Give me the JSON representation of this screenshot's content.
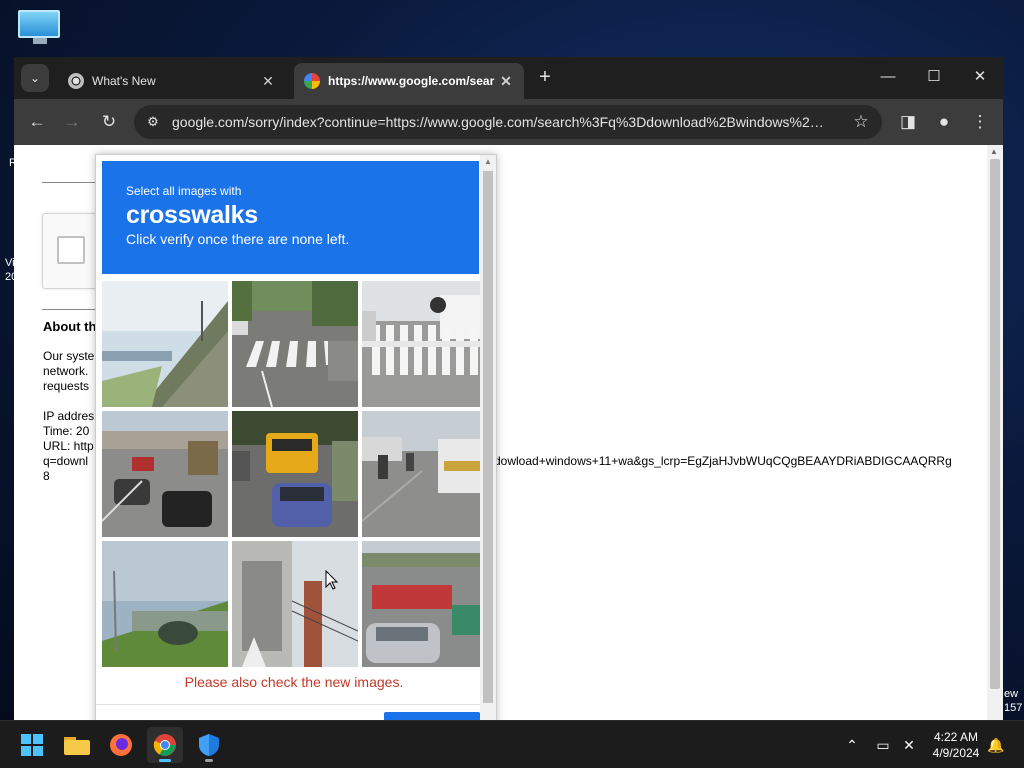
{
  "desktop": {
    "left_fragment_1": "R",
    "left_fragment_2": "Vi",
    "left_fragment_3": "20",
    "right_fragment_1": "ew",
    "right_fragment_2": "157"
  },
  "browser": {
    "tabs": [
      {
        "title": "What's New",
        "icon": "chrome-icon"
      },
      {
        "title": "https://www.google.com/sear",
        "icon": "google-icon"
      }
    ],
    "url": "google.com/sorry/index?continue=https://www.google.com/search%3Fq%3Ddownload%2Bwindows%2B1..."
  },
  "sorry_page": {
    "about_heading": "About th",
    "body_line1": "Our syste",
    "body_line2": "network.",
    "body_line3": "requests",
    "ip_line": "IP addres",
    "time_line": "Time: 20",
    "url_line": "URL: http",
    "q_line": "q=downl",
    "eight_line": "8",
    "url_overflow": "dowload+windows+11+wa&gs_lcrp=EgZjaHJvbWUqCQgBEAAYDRiABDIGCAAQRRg"
  },
  "captcha": {
    "instruction_top": "Select all images with",
    "target": "crosswalks",
    "instruction_bottom": "Click verify once there are none left.",
    "error": "Please also check the new images.",
    "verify_label": "",
    "tiles": [
      "highway-hillside",
      "crosswalk-street",
      "motorcycle-fence",
      "traffic-jam",
      "school-bus-traffic",
      "scooter-road",
      "overpass-grass",
      "building-street",
      "bus-overpass"
    ]
  },
  "taskbar": {
    "time": "4:22 AM",
    "date": "4/9/2024",
    "apps": [
      "start",
      "file-explorer",
      "firefox",
      "chrome",
      "defender"
    ]
  }
}
